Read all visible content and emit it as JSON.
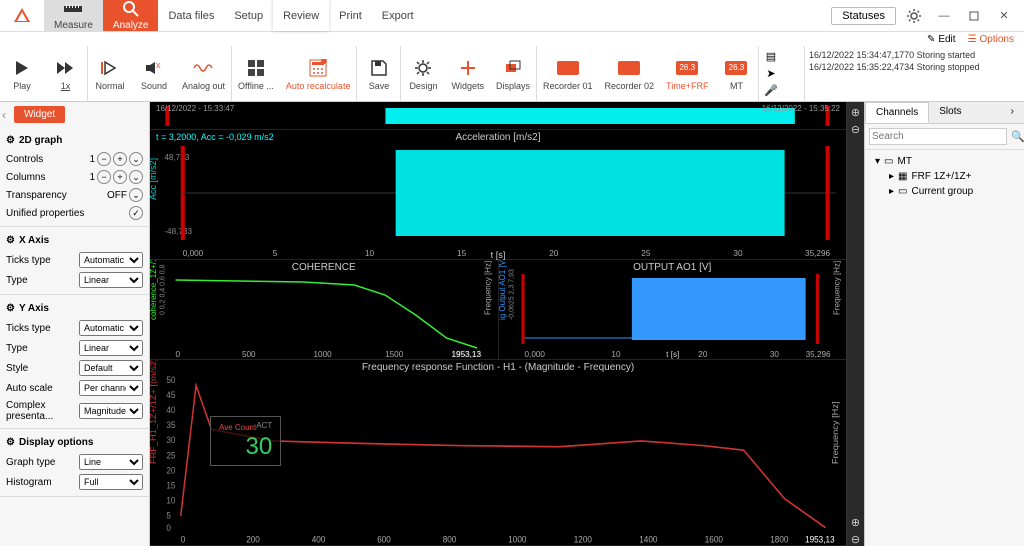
{
  "menubar": {
    "measure": "Measure",
    "analyze": "Analyze",
    "items": [
      "Data files",
      "Setup",
      "Review",
      "Print",
      "Export"
    ],
    "active_index": 2,
    "statuses_btn": "Statuses",
    "edit_link": "Edit",
    "options_link": "Options"
  },
  "toolbar": {
    "items": [
      {
        "label": "Play",
        "icon": "play"
      },
      {
        "label": "1x",
        "icon": "ff"
      },
      {
        "label": "Normal",
        "icon": "normal"
      },
      {
        "label": "Sound",
        "icon": "sound"
      },
      {
        "label": "Analog out",
        "icon": "analog"
      },
      {
        "label": "Offline ...",
        "icon": "offline"
      },
      {
        "label": "Auto recalculate",
        "icon": "recalc",
        "accent": true
      },
      {
        "label": "Save",
        "icon": "save"
      },
      {
        "label": "Design",
        "icon": "design"
      },
      {
        "label": "Widgets",
        "icon": "widgets"
      },
      {
        "label": "Displays",
        "icon": "displays"
      },
      {
        "label": "Recorder 01",
        "icon": "rec"
      },
      {
        "label": "Recorder 02",
        "icon": "rec"
      },
      {
        "label": "Time+FRF",
        "icon": "badge",
        "accent": true,
        "badge_text": "26.3"
      },
      {
        "label": "MT",
        "icon": "badge",
        "badge_text": "26.3"
      }
    ],
    "log": [
      "16/12/2022 15:34:47,1770 Storing started",
      "16/12/2022 15:35:22,4734 Storing stopped"
    ]
  },
  "sidebar": {
    "widget_tab": "Widget",
    "section_2d": "2D graph",
    "controls_label": "Controls",
    "controls_value": "1",
    "columns_label": "Columns",
    "columns_value": "1",
    "transparency_label": "Transparency",
    "transparency_value": "OFF",
    "unified_label": "Unified properties",
    "section_x": "X Axis",
    "ticks_label": "Ticks type",
    "x_ticks": "Automatic",
    "x_type": "Linear",
    "type_label": "Type",
    "section_y": "Y Axis",
    "y_ticks": "Automatic",
    "y_type": "Linear",
    "style_label": "Style",
    "y_style": "Default",
    "autoscale_label": "Auto scale",
    "y_autoscale": "Per channe",
    "complex_label": "Complex presenta...",
    "y_complex": "Magnitude",
    "section_display": "Display options",
    "graphtype_label": "Graph type",
    "graph_type": "Line",
    "histogram_label": "Histogram",
    "histogram": "Full"
  },
  "charts": {
    "top_time_left": "16/12/2022 - 15:33:47",
    "top_time_right": "16/12/2022 - 15:35:22",
    "cursor_info": "t = 3,2000, Acc = -0,029 m/s2",
    "accel_title": "Acceleration [m/s2]",
    "accel_ylabel": "Acc [m/s2]",
    "accel_xlabel": "t [s]",
    "accel_ticks": [
      "0,000",
      "5",
      "10",
      "15",
      "20",
      "25",
      "30",
      "35,296"
    ],
    "coh_title": "COHERENCE",
    "coh_ylabel": "coherence_1Z+/1Z+",
    "coh_yticks": "0 0,2 0,4 0,6 0,8",
    "coh_xticks": [
      "0",
      "500",
      "1000",
      "1500",
      "1953,13"
    ],
    "out_title": "OUTPUT AO1 [V]",
    "out_ylabel": "ig Output AO1 [V",
    "out_xlabel2": "Frequency [Hz]",
    "out_yticks": "-0,0625 2,3 7,93",
    "out_xlabel": "t [s]",
    "out_xticks": [
      "0,000",
      "10",
      "20",
      "30",
      "35,296"
    ],
    "frf_title": "Frequency response Function - H1 - (Magnitude - Frequency)",
    "frf_ylabel": "FRF_H1_1Z+/1Z+ [(m/s2)/V",
    "frf_xlabel": "Frequency [Hz]",
    "frf_yticks": [
      "0",
      "5",
      "10",
      "15",
      "20",
      "25",
      "30",
      "35",
      "40",
      "45",
      "50"
    ],
    "frf_xticks": [
      "0",
      "200",
      "400",
      "600",
      "800",
      "1000",
      "1200",
      "1400",
      "1600",
      "1800",
      "1953,13"
    ],
    "ave_label": "Ave Count",
    "ave_act": "ACT",
    "ave_value": "30"
  },
  "rightbar": {
    "tab_channels": "Channels",
    "tab_slots": "Slots",
    "search_placeholder": "Search",
    "tree_root": "MT",
    "tree_items": [
      "FRF 1Z+/1Z+",
      "Current group"
    ]
  },
  "chart_data": [
    {
      "type": "line",
      "title": "Acceleration [m/s2]",
      "xlabel": "t [s]",
      "ylabel": "Acc [m/s2]",
      "xlim": [
        0,
        35.296
      ],
      "ylim": [
        -48.733,
        48.733
      ],
      "note": "dense noise envelope ~ ±45 from t≈11 to t≈33; near zero elsewhere"
    },
    {
      "type": "line",
      "title": "COHERENCE",
      "xlabel": "Frequency [Hz]",
      "ylabel": "coherence",
      "xlim": [
        0,
        1953.13
      ],
      "ylim": [
        0,
        0.8
      ],
      "series": [
        {
          "name": "coherence_1Z+/1Z+",
          "x": [
            0,
            500,
            900,
            1100,
            1300,
            1500,
            1700,
            1953
          ],
          "values": [
            0.8,
            0.78,
            0.76,
            0.7,
            0.55,
            0.3,
            0.12,
            0.05
          ]
        }
      ]
    },
    {
      "type": "line",
      "title": "OUTPUT AO1 [V]",
      "xlabel": "t [s]",
      "ylabel": "V",
      "xlim": [
        0,
        35.296
      ],
      "ylim": [
        -0.0625,
        7.93
      ],
      "note": "noise burst amplitude ~0..7 from t≈11 to t≈33; ~0 elsewhere"
    },
    {
      "type": "line",
      "title": "Frequency response Function - H1 - (Magnitude - Frequency)",
      "xlabel": "Frequency [Hz]",
      "ylabel": "Magnitude",
      "xlim": [
        0,
        1953.13
      ],
      "ylim": [
        0,
        50
      ],
      "series": [
        {
          "name": "FRF_H1_1Z+/1Z+",
          "x": [
            0,
            50,
            200,
            400,
            600,
            800,
            1000,
            1200,
            1400,
            1600,
            1800,
            1953
          ],
          "values": [
            5,
            48,
            30,
            28,
            27,
            26,
            25,
            24,
            26,
            24,
            10,
            2
          ]
        }
      ]
    }
  ]
}
